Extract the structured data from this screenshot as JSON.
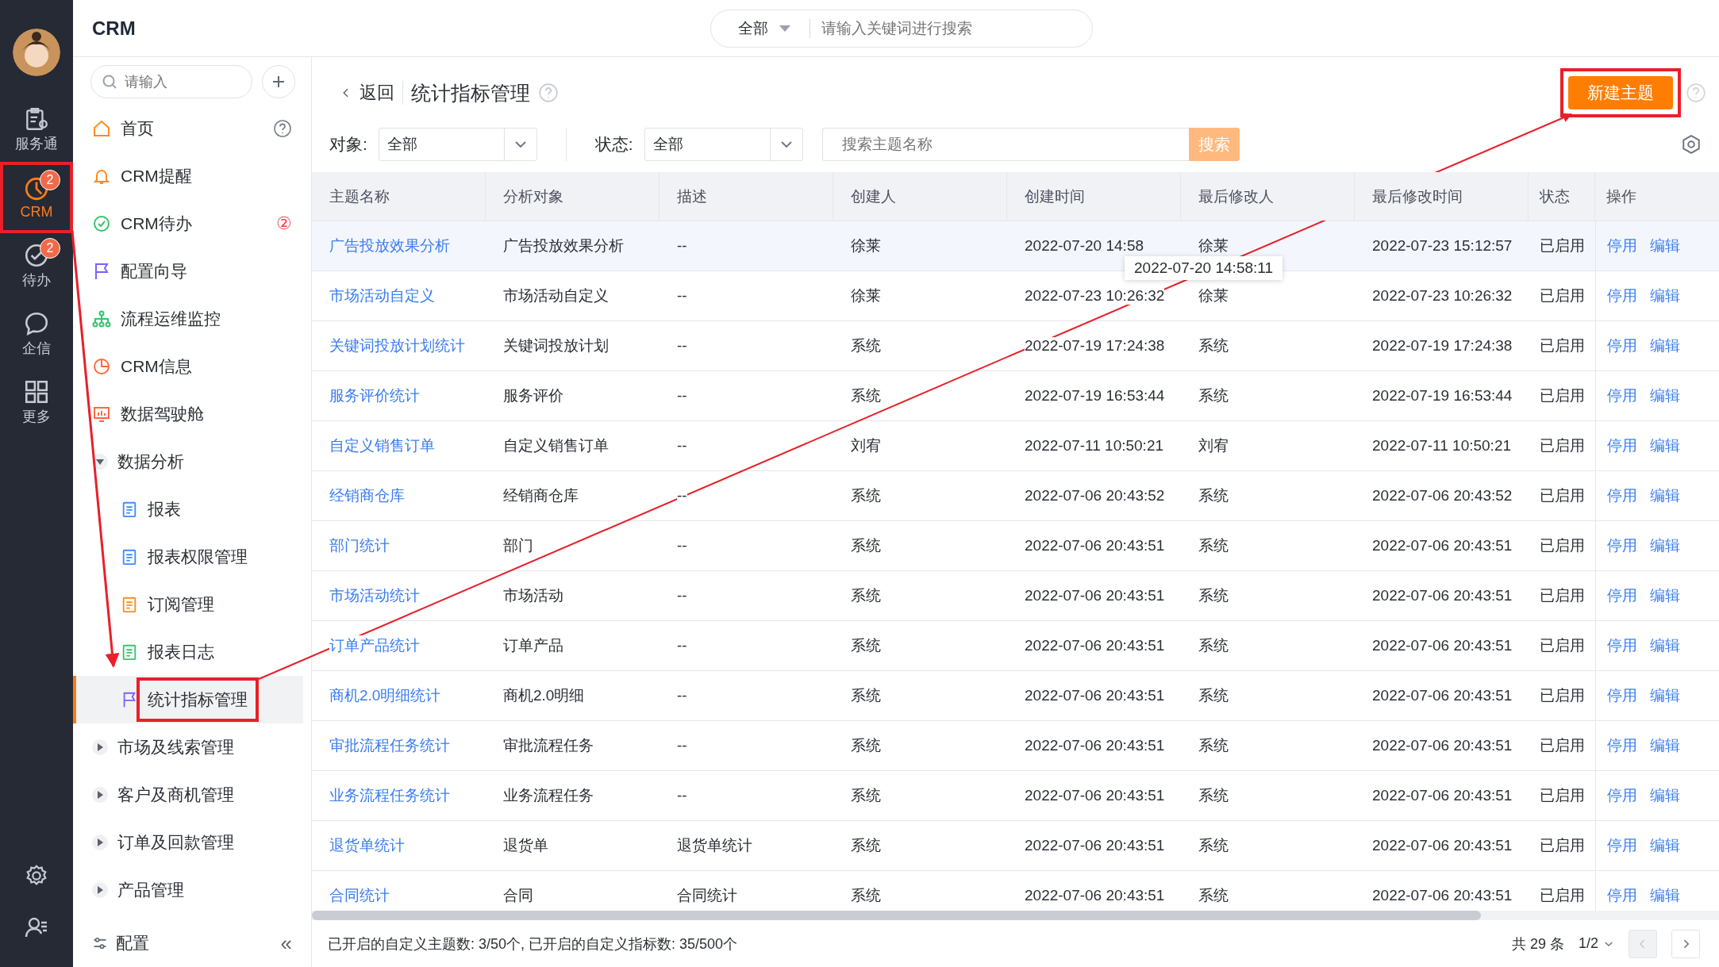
{
  "rail": {
    "items": [
      {
        "label": "服务通",
        "selected": false,
        "highlighted": false
      },
      {
        "label": "CRM",
        "badge": "2",
        "selected": true,
        "highlighted": true
      },
      {
        "label": "待办",
        "badge": "2",
        "selected": false,
        "highlighted": false
      },
      {
        "label": "企信",
        "selected": false,
        "highlighted": false
      },
      {
        "label": "更多",
        "selected": false,
        "highlighted": false
      }
    ]
  },
  "header": {
    "title": "CRM",
    "search": {
      "scope": "全部",
      "placeholder": "请输入关键词进行搜索"
    }
  },
  "sidebar": {
    "search": {
      "placeholder": "请输入"
    },
    "items": [
      {
        "label": "首页",
        "help": true,
        "selected": false
      },
      {
        "label": "CRM提醒",
        "selected": false
      },
      {
        "label": "CRM待办",
        "badge": "②",
        "selected": false
      },
      {
        "label": "配置向导",
        "selected": false
      },
      {
        "label": "流程运维监控",
        "selected": false
      },
      {
        "label": "CRM信息",
        "selected": false
      },
      {
        "label": "数据驾驶舱",
        "selected": false
      },
      {
        "label": "数据分析",
        "expanded": true,
        "children": [
          {
            "label": "报表",
            "selected": false,
            "highlighted": false
          },
          {
            "label": "报表权限管理",
            "selected": false,
            "highlighted": false
          },
          {
            "label": "订阅管理",
            "selected": false,
            "highlighted": false
          },
          {
            "label": "报表日志",
            "selected": false,
            "highlighted": false
          },
          {
            "label": "统计指标管理",
            "selected": true,
            "highlighted": true
          }
        ]
      },
      {
        "label": "市场及线索管理",
        "expanded": false
      },
      {
        "label": "客户及商机管理",
        "expanded": false
      },
      {
        "label": "订单及回款管理",
        "expanded": false
      },
      {
        "label": "产品管理",
        "expanded": false
      }
    ],
    "footer": {
      "label": "配置",
      "collapse": "«"
    }
  },
  "page": {
    "back": "返回",
    "title": "统计指标管理",
    "new_button": {
      "label": "新建主题",
      "highlighted": true
    },
    "filters": [
      {
        "label": "对象:",
        "value": "全部"
      },
      {
        "label": "状态:",
        "value": "全部"
      }
    ],
    "search": {
      "placeholder": "搜索主题名称",
      "button": "搜索"
    }
  },
  "table": {
    "columns": [
      "主题名称",
      "分析对象",
      "描述",
      "创建人",
      "创建时间",
      "最后修改人",
      "最后修改时间",
      "状态",
      "操作"
    ],
    "rows": [
      {
        "selected": true,
        "cells": [
          "广告投放效果分析",
          "广告投放效果分析",
          "--",
          "徐莱",
          "2022-07-20 14:58",
          "徐莱",
          "2022-07-23 15:12:57",
          "已启用"
        ],
        "actions": [
          "停用",
          "编辑"
        ],
        "tooltip": "2022-07-20 14:58:11"
      },
      {
        "selected": false,
        "cells": [
          "市场活动自定义",
          "市场活动自定义",
          "--",
          "徐莱",
          "2022-07-23 10:26:32",
          "徐莱",
          "2022-07-23 10:26:32",
          "已启用"
        ],
        "actions": [
          "停用",
          "编辑"
        ]
      },
      {
        "selected": false,
        "cells": [
          "关键词投放计划统计",
          "关键词投放计划",
          "--",
          "系统",
          "2022-07-19 17:24:38",
          "系统",
          "2022-07-19 17:24:38",
          "已启用"
        ],
        "actions": [
          "停用",
          "编辑"
        ]
      },
      {
        "selected": false,
        "cells": [
          "服务评价统计",
          "服务评价",
          "--",
          "系统",
          "2022-07-19 16:53:44",
          "系统",
          "2022-07-19 16:53:44",
          "已启用"
        ],
        "actions": [
          "停用",
          "编辑"
        ]
      },
      {
        "selected": false,
        "cells": [
          "自定义销售订单",
          "自定义销售订单",
          "--",
          "刘宥",
          "2022-07-11 10:50:21",
          "刘宥",
          "2022-07-11 10:50:21",
          "已启用"
        ],
        "actions": [
          "停用",
          "编辑"
        ]
      },
      {
        "selected": false,
        "cells": [
          "经销商仓库",
          "经销商仓库",
          "--",
          "系统",
          "2022-07-06 20:43:52",
          "系统",
          "2022-07-06 20:43:52",
          "已启用"
        ],
        "actions": [
          "停用",
          "编辑"
        ]
      },
      {
        "selected": false,
        "cells": [
          "部门统计",
          "部门",
          "--",
          "系统",
          "2022-07-06 20:43:51",
          "系统",
          "2022-07-06 20:43:51",
          "已启用"
        ],
        "actions": [
          "停用",
          "编辑"
        ]
      },
      {
        "selected": false,
        "cells": [
          "市场活动统计",
          "市场活动",
          "--",
          "系统",
          "2022-07-06 20:43:51",
          "系统",
          "2022-07-06 20:43:51",
          "已启用"
        ],
        "actions": [
          "停用",
          "编辑"
        ]
      },
      {
        "selected": false,
        "cells": [
          "订单产品统计",
          "订单产品",
          "--",
          "系统",
          "2022-07-06 20:43:51",
          "系统",
          "2022-07-06 20:43:51",
          "已启用"
        ],
        "actions": [
          "停用",
          "编辑"
        ]
      },
      {
        "selected": false,
        "cells": [
          "商机2.0明细统计",
          "商机2.0明细",
          "--",
          "系统",
          "2022-07-06 20:43:51",
          "系统",
          "2022-07-06 20:43:51",
          "已启用"
        ],
        "actions": [
          "停用",
          "编辑"
        ]
      },
      {
        "selected": false,
        "cells": [
          "审批流程任务统计",
          "审批流程任务",
          "--",
          "系统",
          "2022-07-06 20:43:51",
          "系统",
          "2022-07-06 20:43:51",
          "已启用"
        ],
        "actions": [
          "停用",
          "编辑"
        ]
      },
      {
        "selected": false,
        "cells": [
          "业务流程任务统计",
          "业务流程任务",
          "--",
          "系统",
          "2022-07-06 20:43:51",
          "系统",
          "2022-07-06 20:43:51",
          "已启用"
        ],
        "actions": [
          "停用",
          "编辑"
        ]
      },
      {
        "selected": false,
        "cells": [
          "退货单统计",
          "退货单",
          "退货单统计",
          "系统",
          "2022-07-06 20:43:51",
          "系统",
          "2022-07-06 20:43:51",
          "已启用"
        ],
        "actions": [
          "停用",
          "编辑"
        ]
      },
      {
        "selected": false,
        "cells": [
          "合同统计",
          "合同",
          "合同统计",
          "系统",
          "2022-07-06 20:43:51",
          "系统",
          "2022-07-06 20:43:51",
          "已启用"
        ],
        "actions": [
          "停用",
          "编辑"
        ]
      }
    ]
  },
  "footer": {
    "summary": "已开启的自定义主题数: 3/50个, 已开启的自定义指标数: 35/500个",
    "total": "共 29 条",
    "page": "1/2"
  }
}
